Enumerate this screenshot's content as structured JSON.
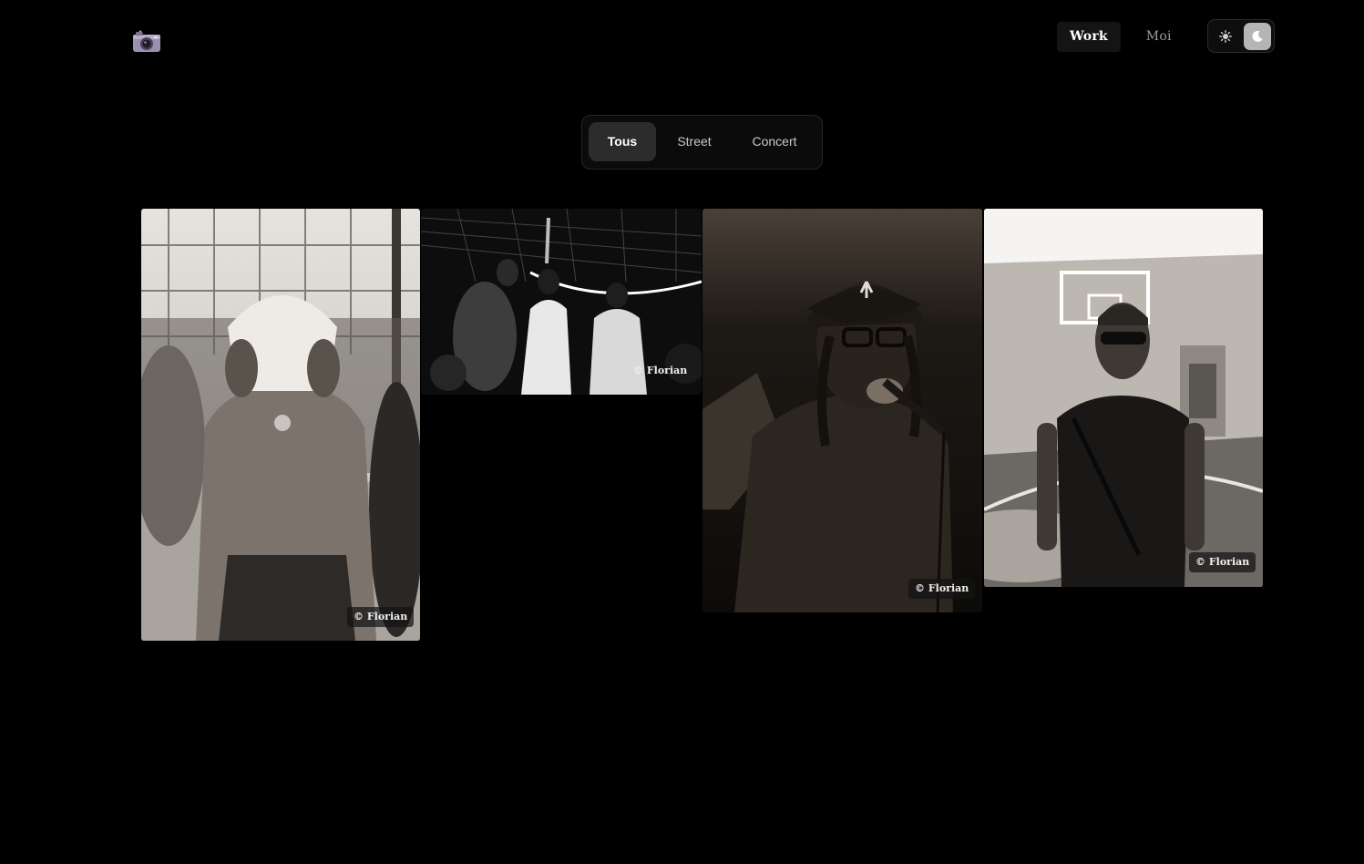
{
  "header": {
    "logo_icon": "camera-icon",
    "nav": [
      {
        "label": "Work",
        "active": true
      },
      {
        "label": "Moi",
        "active": false
      }
    ],
    "theme_toggle": {
      "options": [
        "sun-icon",
        "moon-icon"
      ],
      "selected": "moon-icon"
    }
  },
  "filters": {
    "items": [
      {
        "label": "Tous",
        "active": true
      },
      {
        "label": "Street",
        "active": false
      },
      {
        "label": "Concert",
        "active": false
      }
    ]
  },
  "gallery": {
    "photos": [
      {
        "credit": "© Florian",
        "category": "Street"
      },
      {
        "credit": "© Florian",
        "category": "Concert"
      },
      {
        "credit": "© Florian",
        "category": "Concert"
      },
      {
        "credit": "© Florian",
        "category": "Street"
      }
    ]
  },
  "colors": {
    "background": "#000000",
    "active_nav_bg": "#141414",
    "active_filter_bg": "#2c2c2c",
    "toggle_selected_bg": "#b5b5b5"
  }
}
